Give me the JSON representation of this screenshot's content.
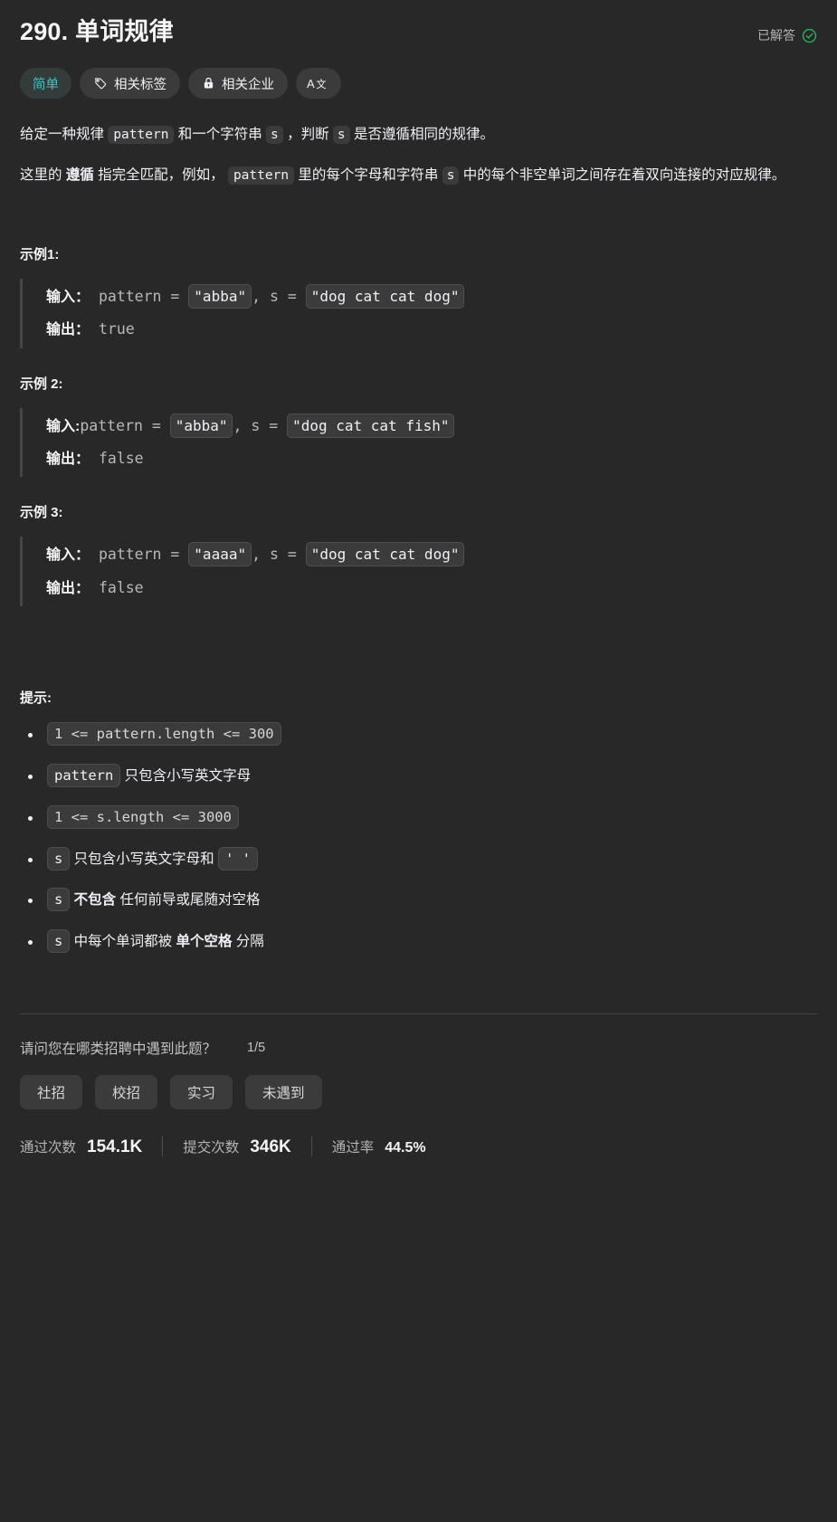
{
  "header": {
    "title": "290. 单词规律",
    "status_text": "已解答",
    "status_icon": "check-circle-icon",
    "status_color": "#2db55d"
  },
  "chips": [
    {
      "label": "简单",
      "icon": null,
      "name": "difficulty-chip"
    },
    {
      "label": "相关标签",
      "icon": "tag-icon",
      "name": "related-tags-chip"
    },
    {
      "label": "相关企业",
      "icon": "lock-icon",
      "name": "related-companies-chip"
    },
    {
      "label": "",
      "icon": "translate-icon",
      "name": "translate-chip"
    }
  ],
  "description": {
    "p1": {
      "t1": "给定一种规律 ",
      "code1": "pattern",
      "t2": " 和一个字符串 ",
      "code2": "s",
      "t3": " ，判断 ",
      "code3": "s",
      "t4": " 是否遵循相同的规律。"
    },
    "p2": {
      "t1": "这里的 ",
      "strong": "遵循",
      "t2": " 指完全匹配，例如， ",
      "code1": "pattern",
      "t3": " 里的每个字母和字符串 ",
      "code2": "s",
      "t4": " 中的每个非空单词之间存在着双向连接的对应规律。"
    }
  },
  "examples": [
    {
      "title": "示例1:",
      "input_label": "输入：",
      "input_prefix": " pattern = ",
      "input_code1": "\"abba\"",
      "input_mid": ", s = ",
      "input_code2": "\"dog cat cat dog\"",
      "output_label": "输出：",
      "output_value": " true"
    },
    {
      "title": "示例 2:",
      "input_label": "输入:",
      "input_prefix": "pattern = ",
      "input_code1": "\"abba\"",
      "input_mid": ", s = ",
      "input_code2": "\"dog cat cat fish\"",
      "output_label": "输出：",
      "output_value": " false"
    },
    {
      "title": "示例 3:",
      "input_label": "输入：",
      "input_prefix": " pattern = ",
      "input_code1": "\"aaaa\"",
      "input_mid": ", s = ",
      "input_code2": "\"dog cat cat dog\"",
      "output_label": "输出：",
      "output_value": " false"
    }
  ],
  "hints": {
    "title": "提示:",
    "items": [
      {
        "code_before": "1 <= pattern.length <= 300",
        "text": "",
        "strong": "",
        "text_after": "",
        "code_after": ""
      },
      {
        "code_before": "pattern",
        "text": " 只包含小写英文字母",
        "strong": "",
        "text_after": "",
        "code_after": ""
      },
      {
        "code_before": "1 <= s.length <= 3000",
        "text": "",
        "strong": "",
        "text_after": "",
        "code_after": ""
      },
      {
        "code_before": "s",
        "text": " 只包含小写英文字母和 ",
        "strong": "",
        "text_after": "",
        "code_after": "' '"
      },
      {
        "code_before": "s",
        "text": " ",
        "strong": "不包含",
        "text_after": " 任何前导或尾随对空格",
        "code_after": ""
      },
      {
        "code_before": "s",
        "text": " 中每个单词都被 ",
        "strong": "单个空格",
        "text_after": " 分隔",
        "code_after": ""
      }
    ]
  },
  "survey": {
    "question": "请问您在哪类招聘中遇到此题？",
    "progress": "1/5",
    "options": [
      "社招",
      "校招",
      "实习",
      "未遇到"
    ]
  },
  "stats": [
    {
      "label": "通过次数",
      "value": "154.1K"
    },
    {
      "label": "提交次数",
      "value": "346K"
    },
    {
      "label": "通过率",
      "value": "44.5%"
    }
  ]
}
